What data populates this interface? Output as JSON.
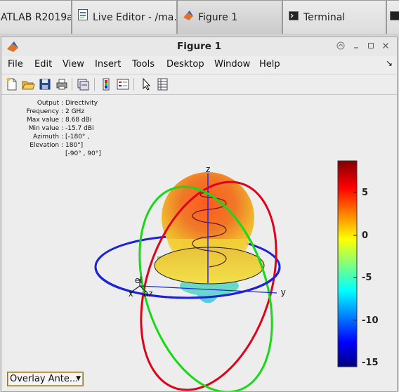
{
  "taskbar": {
    "items": [
      {
        "label": "ATLAB R2019a..."
      },
      {
        "label": "Live Editor - /ma..."
      },
      {
        "label": "Figure 1"
      },
      {
        "label": "Terminal"
      }
    ]
  },
  "window": {
    "title": "Figure 1",
    "menu": [
      "File",
      "Edit",
      "View",
      "Insert",
      "Tools",
      "Desktop",
      "Window",
      "Help"
    ]
  },
  "info": {
    "labels": [
      "Output :",
      "Frequency :",
      "Max value :",
      "Min value :",
      "Azimuth :",
      "Elevation :"
    ],
    "values": [
      "Directivity",
      "2 GHz",
      "8.68 dBi",
      "-15.7 dBi",
      "[-180° ,",
      "180°]",
      "[-90° , 90°]"
    ]
  },
  "axes": {
    "x": "x",
    "y": "y",
    "z": "z",
    "az": "az",
    "el": "el"
  },
  "colorbar": {
    "ticks": [
      "5",
      "0",
      "-5",
      "-10",
      "-15"
    ]
  },
  "popup": {
    "value": "Overlay Ante..."
  },
  "colors": {
    "ring_red": "#e0001a",
    "ring_green": "#18d818",
    "ring_blue": "#1a23d8"
  }
}
